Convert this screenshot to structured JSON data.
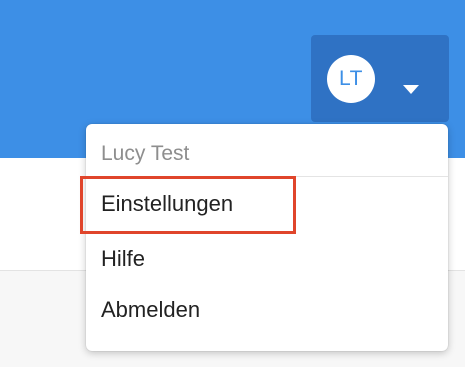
{
  "header": {
    "bg_color": "#3d8fe6",
    "user_menu": {
      "avatar_initials": "LT",
      "toggle_icon": "chevron-down-icon",
      "toggle_bg_color": "#2f72c4"
    }
  },
  "dropdown": {
    "user_name": "Lucy Test",
    "items": [
      {
        "label": "Einstellungen",
        "highlighted": true
      },
      {
        "label": "Hilfe",
        "highlighted": false
      },
      {
        "label": "Abmelden",
        "highlighted": false
      }
    ]
  },
  "annotation": {
    "highlight_color": "#e0452b"
  }
}
